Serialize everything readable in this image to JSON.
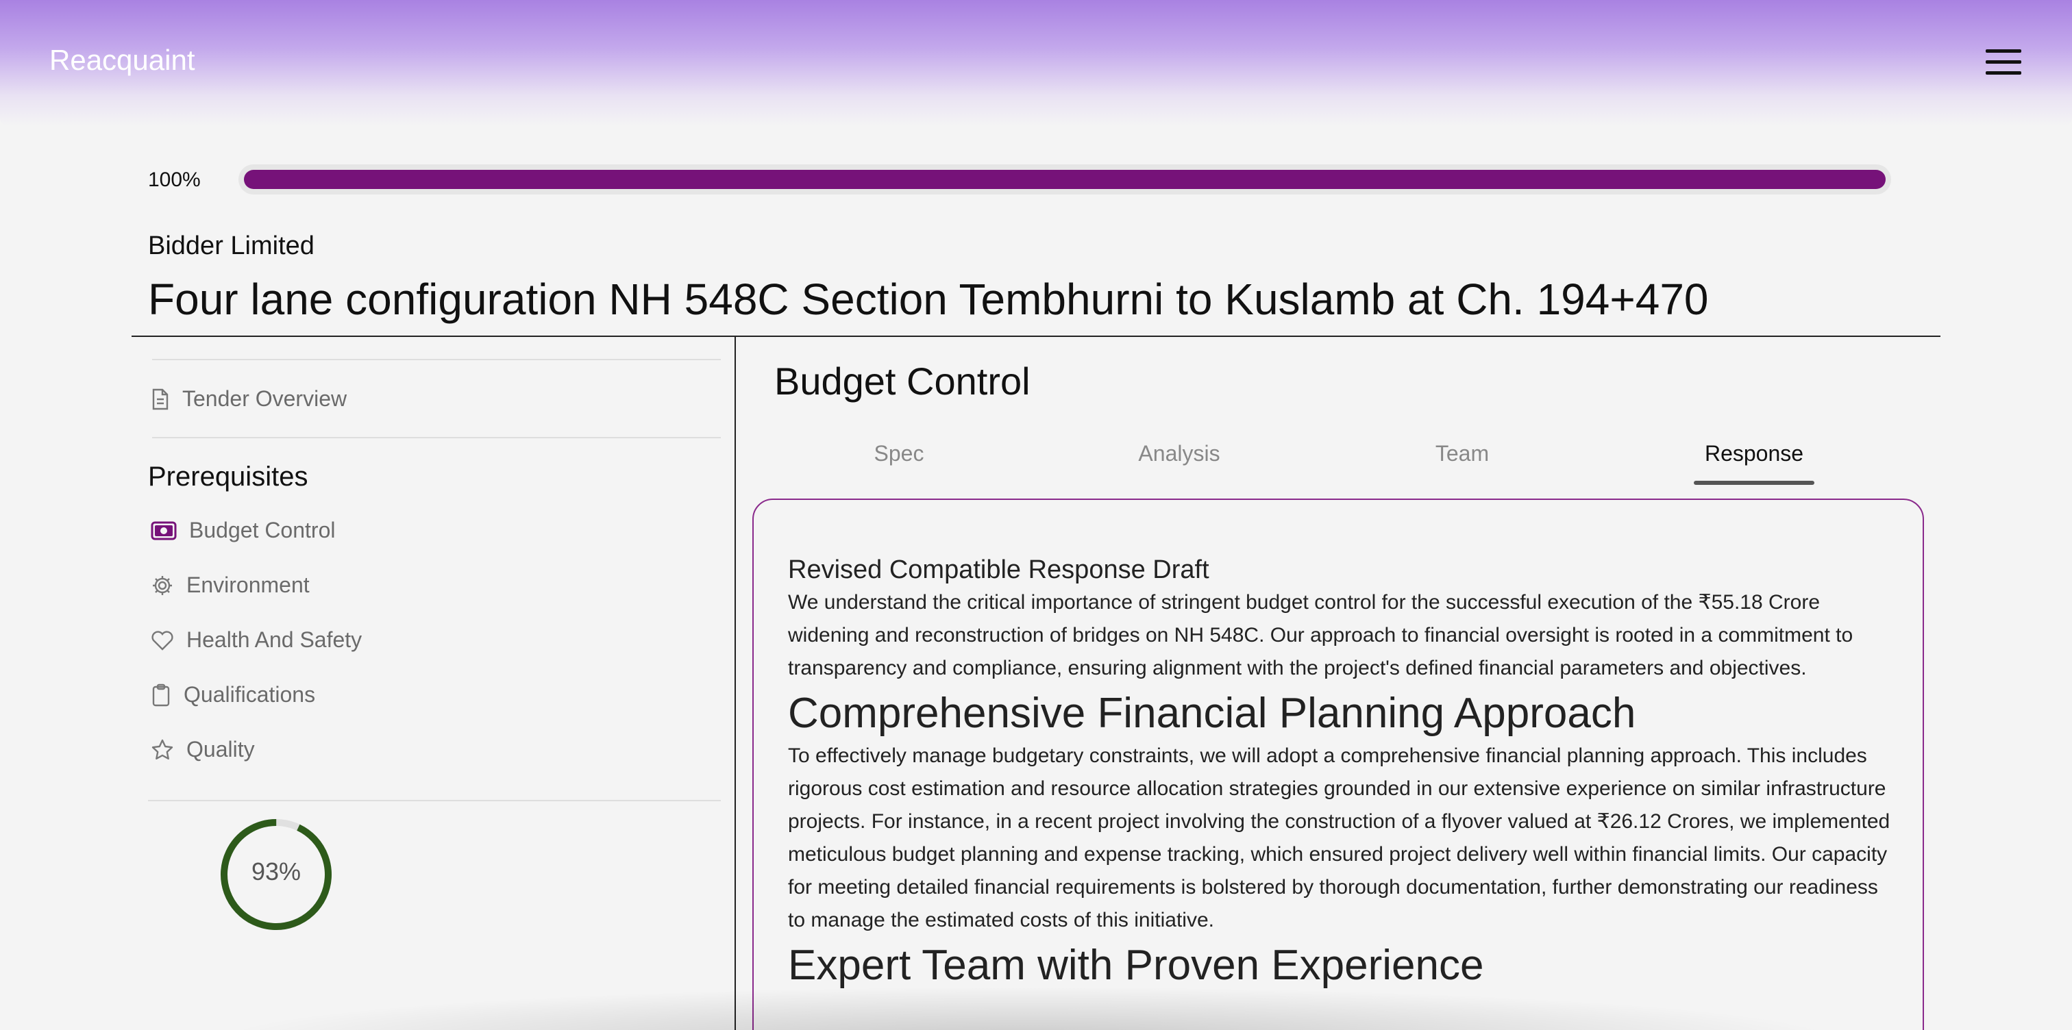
{
  "app": {
    "brand": "Reacquaint"
  },
  "progress": {
    "label": "100%",
    "value": 1.0,
    "color": "#761279"
  },
  "tender": {
    "company": "Bidder Limited",
    "title": "Four lane configuration NH 548C Section Tembhurni to Kuslamb at Ch. 194+470"
  },
  "sidebar": {
    "overview": {
      "label": "Tender Overview",
      "icon": "document-icon"
    },
    "section_heading": "Prerequisites",
    "items": [
      {
        "label": "Budget Control",
        "icon": "money-icon",
        "active": true
      },
      {
        "label": "Environment",
        "icon": "gear-icon"
      },
      {
        "label": "Health And Safety",
        "icon": "heart-icon"
      },
      {
        "label": "Qualifications",
        "icon": "clipboard-icon"
      },
      {
        "label": "Quality",
        "icon": "star-icon"
      }
    ],
    "score": {
      "label": "93%",
      "value": 0.93,
      "color": "#2d5a1a"
    }
  },
  "main": {
    "section_title": "Budget Control",
    "tabs": [
      {
        "label": "Spec"
      },
      {
        "label": "Analysis"
      },
      {
        "label": "Team"
      },
      {
        "label": "Response",
        "active": true
      }
    ],
    "response": {
      "subtitle": "Revised Compatible Response Draft",
      "intro": "We understand the critical importance of stringent budget control for the successful execution of the ₹55.18 Crore widening and reconstruction of bridges on NH 548C. Our approach to financial oversight is rooted in a commitment to transparency and compliance, ensuring alignment with the project's defined financial parameters and objectives.",
      "heading1": "Comprehensive Financial Planning Approach",
      "para1": "To effectively manage budgetary constraints, we will adopt a comprehensive financial planning approach. This includes rigorous cost estimation and resource allocation strategies grounded in our extensive experience on similar infrastructure projects. For instance, in a recent project involving the construction of a flyover valued at ₹26.12 Crores, we implemented meticulous budget planning and expense tracking, which ensured project delivery well within financial limits. Our capacity for meeting detailed financial requirements is bolstered by thorough documentation, further demonstrating our readiness to manage the estimated costs of this initiative.",
      "heading2": "Expert Team with Proven Experience"
    }
  }
}
